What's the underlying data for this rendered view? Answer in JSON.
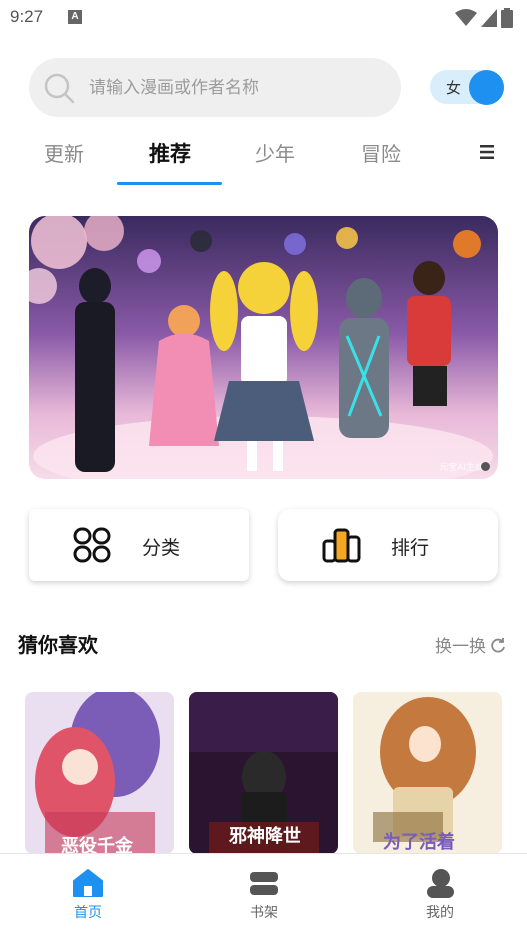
{
  "status": {
    "time": "9:27",
    "notif_letter": "A"
  },
  "search": {
    "placeholder": "请输入漫画或作者名称"
  },
  "gender_toggle": {
    "label": "女"
  },
  "tabs": [
    {
      "label": "更新"
    },
    {
      "label": "推荐"
    },
    {
      "label": "少年"
    },
    {
      "label": "冒险"
    }
  ],
  "banner": {
    "watermark": "元宝AI生成"
  },
  "quick": {
    "category_label": "分类",
    "rank_label": "排行"
  },
  "section": {
    "title": "猜你喜欢",
    "refresh_label": "换一换"
  },
  "covers": [
    {
      "title": "恶役千金"
    },
    {
      "title": "邪神降世"
    },
    {
      "title": "为了活着"
    }
  ],
  "nav": [
    {
      "label": "首页"
    },
    {
      "label": "书架"
    },
    {
      "label": "我的"
    }
  ],
  "colors": {
    "accent": "#1e90f0",
    "toggle_bg": "#d9eefb"
  },
  "icons": [
    "search-icon",
    "menu-icon",
    "category-icon",
    "rank-icon",
    "refresh-icon",
    "home-icon",
    "bookshelf-icon",
    "profile-icon"
  ]
}
